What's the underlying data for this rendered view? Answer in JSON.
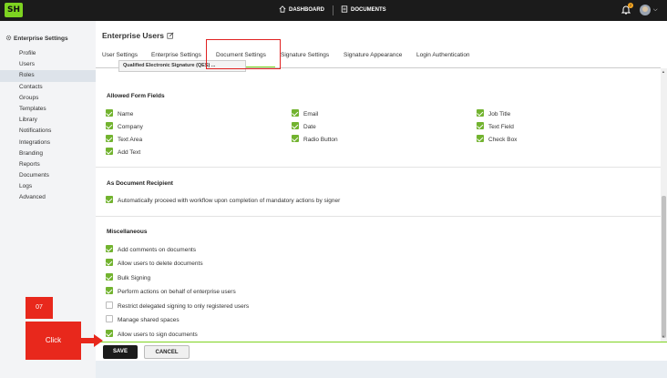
{
  "topbar": {
    "logo": "SH",
    "nav": [
      {
        "label": "DASHBOARD",
        "icon": "home-icon"
      },
      {
        "label": "DOCUMENTS",
        "icon": "document-icon"
      }
    ],
    "notification_count": "2",
    "accent": "#7ed321"
  },
  "sidebar": {
    "title": "Enterprise Settings",
    "items": [
      {
        "label": "Profile"
      },
      {
        "label": "Users"
      },
      {
        "label": "Roles",
        "active": true
      },
      {
        "label": "Contacts"
      },
      {
        "label": "Groups"
      },
      {
        "label": "Templates"
      },
      {
        "label": "Library"
      },
      {
        "label": "Notifications"
      },
      {
        "label": "Integrations"
      },
      {
        "label": "Branding"
      },
      {
        "label": "Reports"
      },
      {
        "label": "Documents"
      },
      {
        "label": "Logs"
      },
      {
        "label": "Advanced"
      }
    ]
  },
  "main": {
    "title": "Enterprise Users",
    "tabs": [
      {
        "label": "User Settings"
      },
      {
        "label": "Enterprise Settings"
      },
      {
        "label": "Document Settings",
        "active": true
      },
      {
        "label": "Signature Settings"
      },
      {
        "label": "Signature Appearance"
      },
      {
        "label": "Login Authentication"
      }
    ],
    "tooltip": "Qualified Electronic Signature (QES) ...",
    "allowed_form_fields": {
      "title": "Allowed Form Fields",
      "columns": [
        [
          {
            "label": "Name",
            "checked": true
          },
          {
            "label": "Company",
            "checked": true
          },
          {
            "label": "Text Area",
            "checked": true
          },
          {
            "label": "Add Text",
            "checked": true
          }
        ],
        [
          {
            "label": "Email",
            "checked": true
          },
          {
            "label": "Date",
            "checked": true
          },
          {
            "label": "Radio Button",
            "checked": true
          }
        ],
        [
          {
            "label": "Job Title",
            "checked": true
          },
          {
            "label": "Text Field",
            "checked": true
          },
          {
            "label": "Check Box",
            "checked": true
          }
        ]
      ]
    },
    "document_recipient": {
      "title": "As Document Recipient",
      "options": [
        {
          "label": "Automatically proceed with workflow upon completion of mandatory actions by signer",
          "checked": true
        }
      ]
    },
    "miscellaneous": {
      "title": "Miscellaneous",
      "options": [
        {
          "label": "Add comments on documents",
          "checked": true
        },
        {
          "label": "Allow users to delete documents",
          "checked": true
        },
        {
          "label": "Bulk Signing",
          "checked": true
        },
        {
          "label": "Perform actions on behalf of enterprise users",
          "checked": true
        },
        {
          "label": "Restrict delegated signing to only registered users",
          "checked": false
        },
        {
          "label": "Manage shared spaces",
          "checked": false
        },
        {
          "label": "Allow users to sign documents",
          "checked": true
        }
      ]
    }
  },
  "footer": {
    "save_label": "SAVE",
    "cancel_label": "CANCEL"
  },
  "overlay": {
    "step": "07",
    "instruction": "Click",
    "color": "#e8281c"
  }
}
